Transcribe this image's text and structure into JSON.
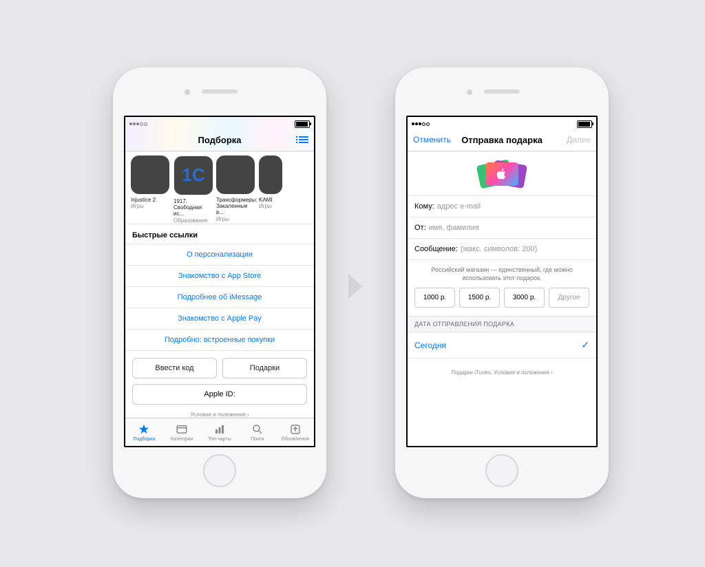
{
  "left": {
    "nav_title": "Подборка",
    "apps": [
      {
        "name": "Injustice 2",
        "category": "Игры"
      },
      {
        "name": "1917. Свободная ис...",
        "category": "Образование"
      },
      {
        "name": "Трансформеры: Закаленные в...",
        "category": "Игры"
      },
      {
        "name": "KAMI",
        "category": "Игры"
      }
    ],
    "quick_links_header": "Быстрые ссылки",
    "quick_links": [
      "О персонализации",
      "Знакомство с App Store",
      "Подробнее об iMessage",
      "Знакомство с Apple Pay",
      "Подробно: встроенные покупки"
    ],
    "btn_code": "Ввести код",
    "btn_gifts": "Подарки",
    "btn_appleid": "Apple ID:",
    "terms": "Условия и положения ›",
    "tabs": [
      "Подборка",
      "Категории",
      "Топ-чарты",
      "Поиск",
      "Обновления"
    ]
  },
  "right": {
    "nav_cancel": "Отменить",
    "nav_title": "Отправка подарка",
    "nav_next": "Далее",
    "field_to_label": "Кому:",
    "field_to_ph": "адрес e-mail",
    "field_from_label": "От:",
    "field_from_ph": "имя, фамилия",
    "field_msg_label": "Сообщение:",
    "field_msg_ph": "(макс. символов: 200)",
    "note": "Российский магазин — единственный, где можно использовать этот подарок.",
    "amounts": [
      "1000 р.",
      "1500 р.",
      "3000 р.",
      "Другое"
    ],
    "date_header": "ДАТА ОТПРАВЛЕНИЯ ПОДАРКА",
    "date_value": "Сегодня",
    "footer": "Подарки iTunes: Условия и положения ›"
  }
}
